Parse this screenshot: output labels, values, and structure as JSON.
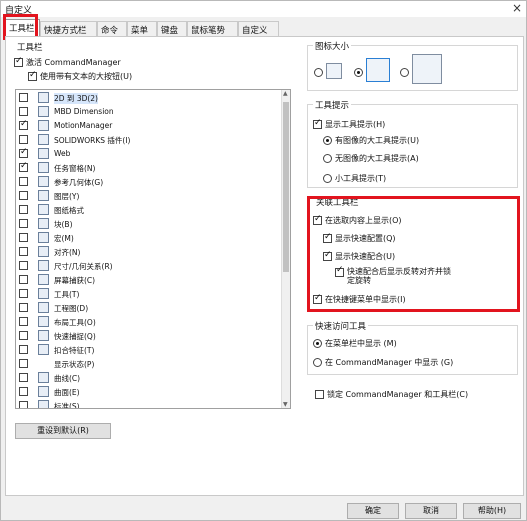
{
  "window": {
    "title": "自定义",
    "close_glyph": "×"
  },
  "tabs": [
    "工具栏",
    "快捷方式栏",
    "命令",
    "菜单",
    "键盘",
    "鼠标笔势",
    "自定义"
  ],
  "toolbars_group": {
    "label": "工具栏",
    "activate_cm": "激活 CommandManager",
    "large_buttons": "使用带有文本的大按钮(U)"
  },
  "toolbar_list": [
    {
      "label": "2D 到 3D(2)",
      "checked": false,
      "icon": "2d-to-3d-icon"
    },
    {
      "label": "MBD Dimension",
      "checked": false,
      "icon": "mbd-icon"
    },
    {
      "label": "MotionManager",
      "checked": true,
      "icon": "motion-icon"
    },
    {
      "label": "SOLIDWORKS 插件(I)",
      "checked": false,
      "icon": "addin-icon"
    },
    {
      "label": "Web",
      "checked": true,
      "icon": "web-icon"
    },
    {
      "label": "任务窗格(N)",
      "checked": true,
      "icon": "task-pane-icon"
    },
    {
      "label": "参考几何体(G)",
      "checked": false,
      "icon": "ref-geometry-icon"
    },
    {
      "label": "图层(Y)",
      "checked": false,
      "icon": "layer-icon"
    },
    {
      "label": "图纸格式",
      "checked": false,
      "icon": "sheet-format-icon"
    },
    {
      "label": "块(B)",
      "checked": false,
      "icon": "block-icon"
    },
    {
      "label": "宏(M)",
      "checked": false,
      "icon": "macro-icon"
    },
    {
      "label": "对齐(N)",
      "checked": false,
      "icon": "align-icon"
    },
    {
      "label": "尺寸/几何关系(R)",
      "checked": false,
      "icon": "dimension-icon"
    },
    {
      "label": "屏幕捕获(C)",
      "checked": false,
      "icon": "screen-capture-icon"
    },
    {
      "label": "工具(T)",
      "checked": false,
      "icon": "tools-icon"
    },
    {
      "label": "工程图(D)",
      "checked": false,
      "icon": "drawing-icon"
    },
    {
      "label": "布局工具(O)",
      "checked": false,
      "icon": "layout-icon"
    },
    {
      "label": "快速捕捉(Q)",
      "checked": false,
      "icon": "quick-snap-icon"
    },
    {
      "label": "扣合特征(T)",
      "checked": false,
      "icon": "fastening-icon"
    },
    {
      "label": "显示状态(P)",
      "checked": false,
      "icon": "display-state-icon"
    },
    {
      "label": "曲线(C)",
      "checked": false,
      "icon": "curve-icon"
    },
    {
      "label": "曲面(E)",
      "checked": false,
      "icon": "surface-icon"
    },
    {
      "label": "标准(S)",
      "checked": false,
      "icon": "standard-icon"
    }
  ],
  "reset_button": "重设到默认(R)",
  "icon_size": {
    "label": "图标大小",
    "selected": 1
  },
  "tooltips": {
    "label": "工具提示",
    "show": "显示工具提示(H)",
    "large_with_image": "有图像的大工具提示(U)",
    "large_no_image": "无图像的大工具提示(A)",
    "small": "小工具提示(T)"
  },
  "context_toolbars": {
    "label": "关联工具栏",
    "show_on_selection": "在选取内容上显示(O)",
    "show_quick_config": "显示快速配置(Q)",
    "show_quick_mates": "显示快速配合(U)",
    "quick_mate_note": "快速配合后显示反转对齐并锁定旋转",
    "show_in_shortcut": "在快捷键菜单中显示(I)"
  },
  "quick_access": {
    "label": "快速访问工具",
    "in_menu": "在菜单栏中显示 (M)",
    "in_cm": "在 CommandManager 中显示 (G)"
  },
  "lock_cm": "锁定 CommandManager 和工具栏(C)",
  "footer": {
    "ok": "确定",
    "cancel": "取消",
    "help": "帮助(H)"
  },
  "colors": {
    "highlight": "#e2141e",
    "accent": "#2a7fd4"
  }
}
